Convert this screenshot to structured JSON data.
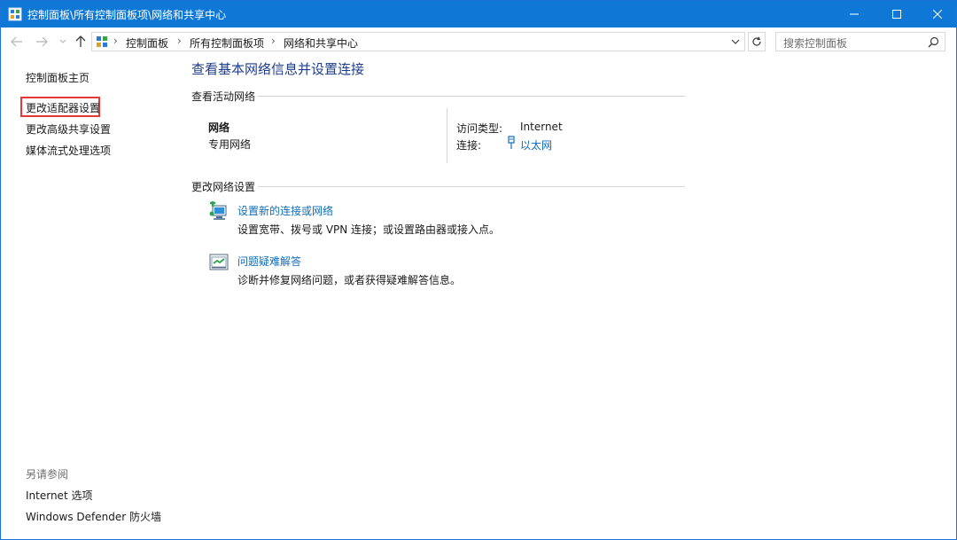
{
  "window": {
    "title": "控制面板\\所有控制面板项\\网络和共享中心"
  },
  "nav": {
    "breadcrumbs": [
      "控制面板",
      "所有控制面板项",
      "网络和共享中心"
    ],
    "search_placeholder": "搜索控制面板"
  },
  "left_pane": {
    "home": "控制面板主页",
    "items": [
      "更改适配器设置",
      "更改高级共享设置",
      "媒体流式处理选项"
    ],
    "see_also_title": "另请参阅",
    "see_also": [
      "Internet 选项",
      "Windows Defender 防火墙"
    ]
  },
  "main": {
    "title": "查看基本网络信息并设置连接",
    "active_section": "查看活动网络",
    "network": {
      "name": "网络",
      "type": "专用网络",
      "access_label": "访问类型:",
      "access_value": "Internet",
      "connection_label": "连接:",
      "connection_value": "以太网"
    },
    "change_section": "更改网络设置",
    "tasks": [
      {
        "link": "设置新的连接或网络",
        "desc": "设置宽带、拨号或 VPN 连接；或设置路由器或接入点。",
        "icon": "new-connection-icon"
      },
      {
        "link": "问题疑难解答",
        "desc": "诊断并修复网络问题，或者获得疑难解答信息。",
        "icon": "troubleshoot-icon"
      }
    ]
  },
  "colors": {
    "titlebar": "#0f78d7",
    "link": "#0f6cbd",
    "heading": "#1e3d8c",
    "highlight": "#e53935"
  }
}
